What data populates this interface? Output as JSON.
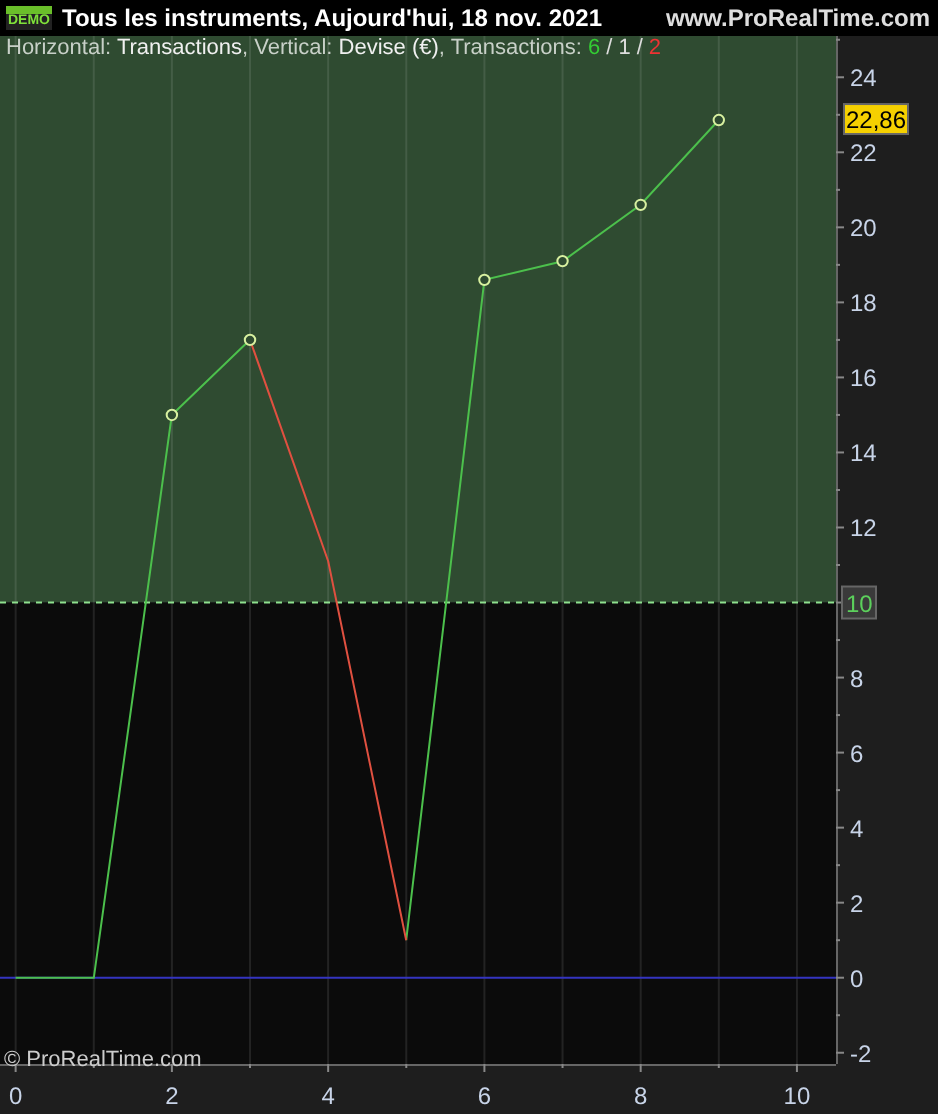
{
  "title_bar": {
    "badge": "DEMO",
    "title": "Tous les instruments, Aujourd'hui, 18 nov. 2021",
    "website": "www.ProRealTime.com"
  },
  "legend": {
    "text": "Horizontal: **Transactions**, Vertical: **Devise (€)**, Transactions: ",
    "separator": "/",
    "counts": [
      {
        "text": "6",
        "color": "#33cc33"
      },
      {
        "text": "1",
        "color": "#dddddd"
      },
      {
        "text": "2",
        "color": "#ee3333"
      }
    ]
  },
  "chart": {
    "price_label": "22,86",
    "threshold_label": "10",
    "copyright": "© ProRealTime.com",
    "chart_data": {
      "type": "line",
      "x": [
        0,
        1,
        2,
        3,
        4,
        5,
        6,
        7,
        8,
        9
      ],
      "series": [
        {
          "color": "#4cc04c",
          "values": [
            0,
            0,
            15,
            17,
            null,
            1,
            18.6,
            19.1,
            20.6,
            22.86
          ]
        },
        {
          "color": "#e05040",
          "values": [
            null,
            null,
            null,
            17,
            11.1,
            1,
            null,
            null,
            null,
            null
          ]
        }
      ],
      "grid": true,
      "ref_lines": [
        {
          "axis": "y",
          "value": 10,
          "color": "#8ee08e"
        },
        {
          "axis": "y",
          "value": 0,
          "color": "#3434c0"
        }
      ],
      "xlim": [
        -0.2,
        10.5
      ],
      "ylim": [
        -2.3,
        25.1
      ],
      "xticks": [
        0,
        2,
        4,
        6,
        8,
        10
      ],
      "yticks": [
        -2,
        0,
        2,
        4,
        6,
        8,
        10,
        12,
        14,
        16,
        18,
        20,
        22,
        24
      ]
    }
  }
}
